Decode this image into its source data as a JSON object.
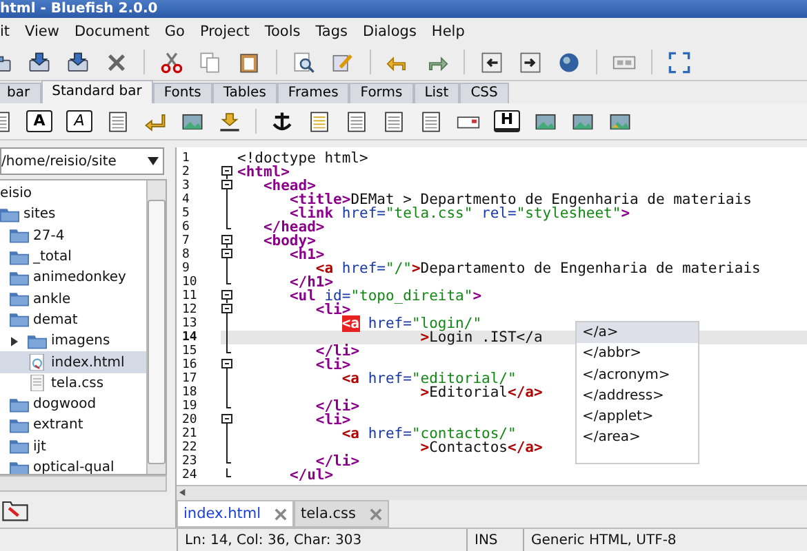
{
  "window": {
    "title": "html - Bluefish 2.0.0"
  },
  "menu": [
    "it",
    "View",
    "Document",
    "Go",
    "Project",
    "Tools",
    "Tags",
    "Dialogs",
    "Help"
  ],
  "toolbar_tabs": [
    {
      "label": "bar",
      "selected": false
    },
    {
      "label": "Standard bar",
      "selected": true
    },
    {
      "label": "Fonts",
      "selected": false
    },
    {
      "label": "Tables",
      "selected": false
    },
    {
      "label": "Frames",
      "selected": false
    },
    {
      "label": "Forms",
      "selected": false
    },
    {
      "label": "List",
      "selected": false
    },
    {
      "label": "CSS",
      "selected": false
    }
  ],
  "letter_buttons": [
    "A",
    "A",
    "H"
  ],
  "file_browser": {
    "path": "/home/reisio/site",
    "tree": [
      {
        "name": "eisio",
        "selected": false,
        "children": [
          {
            "name": "sites",
            "kind": "folder",
            "selected": false,
            "children": [
              {
                "name": "27-4",
                "kind": "folder",
                "selected": false
              },
              {
                "name": "_total",
                "kind": "folder",
                "selected": false
              },
              {
                "name": "animedonkey",
                "kind": "folder",
                "selected": false
              },
              {
                "name": "ankle",
                "kind": "folder",
                "selected": false
              },
              {
                "name": "demat",
                "kind": "folder",
                "selected": false,
                "children": [
                  {
                    "name": "imagens",
                    "kind": "folder",
                    "selected": false,
                    "expanded": false
                  },
                  {
                    "name": "index.html",
                    "kind": "html",
                    "selected": true
                  },
                  {
                    "name": "tela.css",
                    "kind": "css",
                    "selected": false
                  }
                ]
              },
              {
                "name": "dogwood",
                "kind": "folder",
                "selected": false
              },
              {
                "name": "extrant",
                "kind": "folder",
                "selected": false
              },
              {
                "name": "ijt",
                "kind": "folder",
                "selected": false
              },
              {
                "name": "optical-qual",
                "kind": "folder",
                "selected": false
              }
            ]
          }
        ]
      }
    ]
  },
  "editor": {
    "lines": [
      {
        "number": "1",
        "kind": "plain",
        "current": false,
        "segments": [
          {
            "kind": "text",
            "text": "<!doctype html>"
          }
        ]
      },
      {
        "number": "2",
        "kind": "fold_start",
        "current": false,
        "segments": [
          {
            "kind": "tag",
            "text": "<html>"
          }
        ]
      },
      {
        "number": "3",
        "kind": "fold_start",
        "current": false,
        "segments": [
          {
            "kind": "tag",
            "text": "   <head>"
          }
        ]
      },
      {
        "number": "4",
        "kind": "fold_inner",
        "current": false,
        "segments": [
          {
            "kind": "tag",
            "text": "      <title>"
          },
          {
            "kind": "text",
            "text": "DEMat > Departmento de Engenharia de materiais"
          }
        ]
      },
      {
        "number": "5",
        "kind": "fold_inner",
        "current": false,
        "segments": [
          {
            "kind": "tag",
            "text": "      <link"
          },
          {
            "kind": "attr",
            "text": " href="
          },
          {
            "kind": "string",
            "text": "\"tela.css\""
          },
          {
            "kind": "attr",
            "text": " rel="
          },
          {
            "kind": "string",
            "text": "\"stylesheet\""
          },
          {
            "kind": "tag",
            "text": ">"
          }
        ]
      },
      {
        "number": "6",
        "kind": "fold_end",
        "current": false,
        "segments": [
          {
            "kind": "tag",
            "text": "   </head>"
          }
        ]
      },
      {
        "number": "7",
        "kind": "fold_start",
        "current": false,
        "segments": [
          {
            "kind": "tag",
            "text": "   <body>"
          }
        ]
      },
      {
        "number": "8",
        "kind": "fold_start",
        "current": false,
        "segments": [
          {
            "kind": "tag",
            "text": "      <h1>"
          }
        ]
      },
      {
        "number": "9",
        "kind": "fold_inner",
        "current": false,
        "segments": [
          {
            "kind": "anchor",
            "text": "         <a"
          },
          {
            "kind": "attr",
            "text": " href="
          },
          {
            "kind": "string",
            "text": "\"/\""
          },
          {
            "kind": "anchor",
            "text": ">"
          },
          {
            "kind": "text",
            "text": "Departamento de Engenharia de materiais"
          }
        ]
      },
      {
        "number": "10",
        "kind": "fold_end",
        "current": false,
        "segments": [
          {
            "kind": "tag",
            "text": "      </h1>"
          }
        ]
      },
      {
        "number": "11",
        "kind": "fold_start",
        "current": false,
        "segments": [
          {
            "kind": "tag",
            "text": "      <ul"
          },
          {
            "kind": "attr",
            "text": " id="
          },
          {
            "kind": "string",
            "text": "\"topo_direita\""
          },
          {
            "kind": "tag",
            "text": ">"
          }
        ]
      },
      {
        "number": "12",
        "kind": "fold_start",
        "current": false,
        "segments": [
          {
            "kind": "tag",
            "text": "         <li>"
          }
        ]
      },
      {
        "number": "13",
        "kind": "fold_inner",
        "current": false,
        "segments": [
          {
            "kind": "error",
            "text": "            <a"
          },
          {
            "kind": "attr",
            "text": " href="
          },
          {
            "kind": "string",
            "text": "\"login/\""
          }
        ]
      },
      {
        "number": "14",
        "kind": "fold_inner",
        "current": true,
        "segments": [
          {
            "kind": "anchor",
            "text": "                     >"
          },
          {
            "kind": "text",
            "text": "Login .IST</a"
          }
        ]
      },
      {
        "number": "15",
        "kind": "fold_end",
        "current": false,
        "segments": [
          {
            "kind": "tag",
            "text": "         </li>"
          }
        ]
      },
      {
        "number": "16",
        "kind": "fold_start",
        "current": false,
        "segments": [
          {
            "kind": "tag",
            "text": "         <li>"
          }
        ]
      },
      {
        "number": "17",
        "kind": "fold_inner",
        "current": false,
        "segments": [
          {
            "kind": "anchor",
            "text": "            <a"
          },
          {
            "kind": "attr",
            "text": " href="
          },
          {
            "kind": "string",
            "text": "\"editorial/\""
          }
        ]
      },
      {
        "number": "18",
        "kind": "fold_inner",
        "current": false,
        "segments": [
          {
            "kind": "anchor",
            "text": "                     >"
          },
          {
            "kind": "text",
            "text": "Editorial"
          },
          {
            "kind": "anchor",
            "text": "</a>"
          }
        ]
      },
      {
        "number": "19",
        "kind": "fold_end",
        "current": false,
        "segments": [
          {
            "kind": "tag",
            "text": "         </li>"
          }
        ]
      },
      {
        "number": "20",
        "kind": "fold_start",
        "current": false,
        "segments": [
          {
            "kind": "tag",
            "text": "         <li>"
          }
        ]
      },
      {
        "number": "21",
        "kind": "fold_inner",
        "current": false,
        "segments": [
          {
            "kind": "anchor",
            "text": "            <a"
          },
          {
            "kind": "attr",
            "text": " href="
          },
          {
            "kind": "string",
            "text": "\"contactos/\""
          }
        ]
      },
      {
        "number": "22",
        "kind": "fold_inner",
        "current": false,
        "segments": [
          {
            "kind": "anchor",
            "text": "                     >"
          },
          {
            "kind": "text",
            "text": "Contactos"
          },
          {
            "kind": "anchor",
            "text": "</a>"
          }
        ]
      },
      {
        "number": "23",
        "kind": "fold_end",
        "current": false,
        "segments": [
          {
            "kind": "tag",
            "text": "         </li>"
          }
        ]
      },
      {
        "number": "24",
        "kind": "fold_end",
        "current": false,
        "segments": [
          {
            "kind": "tag",
            "text": "      </ul>"
          }
        ]
      }
    ],
    "autocomplete": [
      {
        "text": "</a>",
        "selected": true
      },
      {
        "text": "</abbr>",
        "selected": false
      },
      {
        "text": "</acronym>",
        "selected": false
      },
      {
        "text": "</address>",
        "selected": false
      },
      {
        "text": "</applet>",
        "selected": false
      },
      {
        "text": "</area>",
        "selected": false
      }
    ]
  },
  "document_tabs": [
    {
      "label": "index.html",
      "selected": true
    },
    {
      "label": "tela.css",
      "selected": false
    }
  ],
  "status_bar": {
    "position": "Ln: 14, Col: 36, Char: 303",
    "mode": "INS",
    "file_type": "Generic HTML, UTF-8"
  }
}
